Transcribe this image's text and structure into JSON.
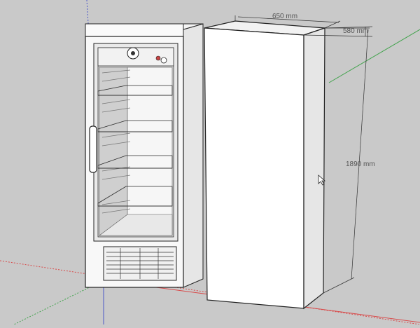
{
  "window": {
    "title": ""
  },
  "dimensions": {
    "width": "650 mm",
    "depth": "580 mm",
    "height": "1890 mm"
  },
  "colors": {
    "background": "#c9c9c9",
    "axis_red": "#d84a4a",
    "axis_green": "#3fa24a",
    "axis_blue": "#4b57c8",
    "model_face": "#ffffff",
    "model_side": "#e6e6e6"
  },
  "icons": {
    "cursor": "mouse-pointer-icon"
  }
}
